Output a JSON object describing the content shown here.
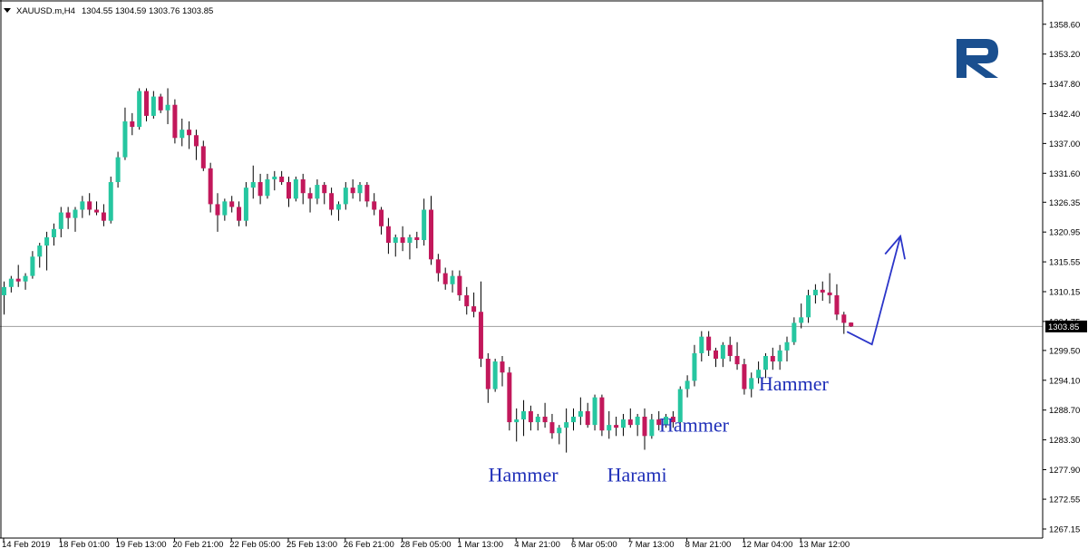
{
  "header": {
    "symbol": "XAUUSD.m,H4",
    "ohlc": "1304.55 1304.59 1303.76 1303.85"
  },
  "colors": {
    "bull": "#26c6a0",
    "bear": "#c2185b",
    "wick": "#000000",
    "price_line": "#9e9e9e",
    "annotation": "#1f2fb8",
    "arrow": "#2b35c9",
    "logo": "#1a4f8f"
  },
  "logo": {
    "icon": "roboforex-r-logo"
  },
  "annotations": [
    {
      "text": "Hammer",
      "anchor_candle": 73
    },
    {
      "text": "Harami",
      "anchor_candle": 89
    },
    {
      "text": "Hammer",
      "anchor_candle": 97
    },
    {
      "text": "Hammer",
      "anchor_candle": 111
    }
  ],
  "forecast_arrow": {
    "icon": "forecast-arrow-icon",
    "points": [
      [
        118.5,
        1302.9
      ],
      [
        122,
        1300.6
      ],
      [
        126,
        1320.2
      ]
    ]
  },
  "chart_data": {
    "type": "candlestick",
    "title": "XAUUSD.m,H4",
    "current_price": 1303.85,
    "current_price_label": "1303.85",
    "ylim": [
      1266.0,
      1362.5
    ],
    "xlim": [
      0,
      146
    ],
    "y_ticks": [
      1358.6,
      1353.2,
      1347.8,
      1342.4,
      1337.0,
      1331.6,
      1326.35,
      1320.95,
      1315.55,
      1310.15,
      1304.75,
      1299.5,
      1294.1,
      1288.7,
      1283.3,
      1277.9,
      1272.55,
      1267.15
    ],
    "y_tick_labels": [
      "1358.60",
      "1353.20",
      "1347.80",
      "1342.40",
      "1337.00",
      "1331.60",
      "1326.35",
      "1320.95",
      "1315.55",
      "1310.15",
      "1304.75",
      "1299.50",
      "1294.10",
      "1288.70",
      "1283.30",
      "1277.90",
      "1272.55",
      "1267.15"
    ],
    "x_ticks": [
      {
        "index": 0,
        "label": "14 Feb 2019"
      },
      {
        "index": 8,
        "label": "18 Feb 01:00"
      },
      {
        "index": 16,
        "label": "19 Feb 13:00"
      },
      {
        "index": 24,
        "label": "20 Feb 21:00"
      },
      {
        "index": 32,
        "label": "22 Feb 05:00"
      },
      {
        "index": 40,
        "label": "25 Feb 13:00"
      },
      {
        "index": 48,
        "label": "26 Feb 21:00"
      },
      {
        "index": 56,
        "label": "28 Feb 05:00"
      },
      {
        "index": 64,
        "label": "1 Mar 13:00"
      },
      {
        "index": 72,
        "label": "4 Mar 21:00"
      },
      {
        "index": 80,
        "label": "6 Mar 05:00"
      },
      {
        "index": 88,
        "label": "7 Mar 13:00"
      },
      {
        "index": 96,
        "label": "8 Mar 21:00"
      },
      {
        "index": 104,
        "label": "12 Mar 04:00"
      },
      {
        "index": 112,
        "label": "13 Mar 12:00"
      }
    ],
    "candles": [
      [
        1309.5,
        1312.0,
        1306.0,
        1311.0
      ],
      [
        1311.0,
        1313.0,
        1310.0,
        1312.5
      ],
      [
        1312.5,
        1315.0,
        1311.0,
        1312.0
      ],
      [
        1312.0,
        1313.5,
        1310.5,
        1313.0
      ],
      [
        1313.0,
        1317.5,
        1312.5,
        1316.5
      ],
      [
        1316.5,
        1319.0,
        1314.5,
        1318.5
      ],
      [
        1318.5,
        1321.0,
        1314.0,
        1320.0
      ],
      [
        1320.0,
        1322.5,
        1318.5,
        1321.5
      ],
      [
        1321.5,
        1325.5,
        1320.0,
        1324.5
      ],
      [
        1324.5,
        1325.5,
        1321.5,
        1323.5
      ],
      [
        1323.5,
        1325.5,
        1321.0,
        1325.0
      ],
      [
        1325.0,
        1327.5,
        1323.5,
        1326.5
      ],
      [
        1326.5,
        1328.0,
        1324.0,
        1325.0
      ],
      [
        1325.0,
        1326.5,
        1324.0,
        1324.5
      ],
      [
        1324.5,
        1326.0,
        1322.0,
        1323.0
      ],
      [
        1323.0,
        1331.0,
        1322.5,
        1330.0
      ],
      [
        1330.0,
        1335.5,
        1329.0,
        1334.5
      ],
      [
        1334.5,
        1343.5,
        1334.0,
        1341.0
      ],
      [
        1341.0,
        1342.5,
        1338.5,
        1340.0
      ],
      [
        1340.0,
        1347.0,
        1339.5,
        1346.5
      ],
      [
        1346.5,
        1347.0,
        1341.0,
        1342.0
      ],
      [
        1342.0,
        1346.5,
        1341.5,
        1345.5
      ],
      [
        1345.5,
        1346.0,
        1342.5,
        1343.0
      ],
      [
        1343.0,
        1347.0,
        1340.5,
        1344.0
      ],
      [
        1344.0,
        1345.0,
        1337.0,
        1338.0
      ],
      [
        1338.0,
        1341.5,
        1336.5,
        1339.5
      ],
      [
        1339.5,
        1341.0,
        1336.0,
        1338.5
      ],
      [
        1338.5,
        1339.5,
        1334.0,
        1336.5
      ],
      [
        1336.5,
        1337.5,
        1332.0,
        1332.5
      ],
      [
        1332.5,
        1333.5,
        1324.5,
        1326.0
      ],
      [
        1326.0,
        1328.0,
        1321.0,
        1324.0
      ],
      [
        1324.0,
        1327.0,
        1323.0,
        1326.5
      ],
      [
        1326.5,
        1327.5,
        1324.5,
        1325.5
      ],
      [
        1325.5,
        1326.5,
        1322.0,
        1323.0
      ],
      [
        1323.0,
        1330.0,
        1322.0,
        1329.0
      ],
      [
        1329.0,
        1333.0,
        1327.0,
        1330.0
      ],
      [
        1330.0,
        1331.5,
        1326.0,
        1327.5
      ],
      [
        1327.5,
        1331.5,
        1327.0,
        1330.5
      ],
      [
        1330.5,
        1332.0,
        1328.5,
        1331.0
      ],
      [
        1331.0,
        1332.0,
        1329.5,
        1330.0
      ],
      [
        1330.0,
        1331.0,
        1325.5,
        1327.0
      ],
      [
        1327.0,
        1331.0,
        1326.5,
        1330.5
      ],
      [
        1330.5,
        1331.5,
        1326.0,
        1328.0
      ],
      [
        1328.0,
        1329.0,
        1324.5,
        1327.0
      ],
      [
        1327.0,
        1330.5,
        1326.0,
        1329.5
      ],
      [
        1329.5,
        1330.0,
        1326.0,
        1328.0
      ],
      [
        1328.0,
        1329.0,
        1324.0,
        1325.0
      ],
      [
        1325.0,
        1326.5,
        1323.0,
        1326.0
      ],
      [
        1326.0,
        1330.0,
        1325.0,
        1329.0
      ],
      [
        1329.0,
        1330.5,
        1327.0,
        1328.0
      ],
      [
        1328.0,
        1330.0,
        1326.5,
        1329.5
      ],
      [
        1329.5,
        1330.0,
        1325.5,
        1326.5
      ],
      [
        1326.5,
        1328.0,
        1324.0,
        1325.0
      ],
      [
        1325.0,
        1325.5,
        1320.5,
        1322.0
      ],
      [
        1322.0,
        1323.5,
        1317.0,
        1319.0
      ],
      [
        1319.0,
        1320.5,
        1316.5,
        1320.0
      ],
      [
        1320.0,
        1322.0,
        1317.5,
        1319.0
      ],
      [
        1319.0,
        1320.5,
        1316.0,
        1320.0
      ],
      [
        1320.0,
        1321.0,
        1318.0,
        1319.5
      ],
      [
        1319.5,
        1327.0,
        1318.5,
        1325.0
      ],
      [
        1325.0,
        1327.5,
        1315.0,
        1316.0
      ],
      [
        1316.0,
        1317.0,
        1312.0,
        1313.5
      ],
      [
        1313.5,
        1314.5,
        1310.5,
        1311.5
      ],
      [
        1311.5,
        1314.0,
        1310.0,
        1313.0
      ],
      [
        1313.0,
        1314.0,
        1308.5,
        1309.5
      ],
      [
        1309.5,
        1311.0,
        1306.0,
        1307.5
      ],
      [
        1307.5,
        1310.0,
        1305.5,
        1306.5
      ],
      [
        1306.5,
        1312.0,
        1296.5,
        1298.0
      ],
      [
        1298.0,
        1299.0,
        1290.0,
        1292.5
      ],
      [
        1292.5,
        1298.0,
        1292.0,
        1297.5
      ],
      [
        1297.5,
        1298.5,
        1293.0,
        1295.5
      ],
      [
        1295.5,
        1296.5,
        1285.0,
        1286.5
      ],
      [
        1286.5,
        1289.0,
        1283.0,
        1287.0
      ],
      [
        1287.0,
        1290.5,
        1284.0,
        1288.5
      ],
      [
        1288.5,
        1289.5,
        1285.0,
        1286.5
      ],
      [
        1286.5,
        1288.0,
        1285.0,
        1287.5
      ],
      [
        1287.5,
        1290.0,
        1285.5,
        1286.5
      ],
      [
        1286.5,
        1288.0,
        1283.5,
        1284.5
      ],
      [
        1284.5,
        1286.0,
        1282.5,
        1285.5
      ],
      [
        1285.5,
        1289.0,
        1281.0,
        1286.5
      ],
      [
        1286.5,
        1289.0,
        1285.0,
        1287.5
      ],
      [
        1287.5,
        1291.0,
        1286.0,
        1288.5
      ],
      [
        1288.5,
        1290.0,
        1285.5,
        1286.0
      ],
      [
        1286.0,
        1291.5,
        1285.0,
        1291.0
      ],
      [
        1291.0,
        1291.5,
        1284.0,
        1285.0
      ],
      [
        1285.0,
        1288.5,
        1283.5,
        1286.0
      ],
      [
        1286.0,
        1287.5,
        1284.0,
        1285.5
      ],
      [
        1285.5,
        1288.0,
        1284.0,
        1287.0
      ],
      [
        1287.0,
        1289.0,
        1285.5,
        1286.0
      ],
      [
        1286.0,
        1288.0,
        1284.0,
        1287.5
      ],
      [
        1287.5,
        1289.0,
        1281.5,
        1284.0
      ],
      [
        1284.0,
        1288.0,
        1283.5,
        1287.0
      ],
      [
        1287.0,
        1288.5,
        1285.0,
        1286.0
      ],
      [
        1286.0,
        1288.0,
        1285.5,
        1287.5
      ],
      [
        1287.5,
        1288.5,
        1285.5,
        1286.5
      ],
      [
        1286.5,
        1293.0,
        1286.0,
        1292.5
      ],
      [
        1292.5,
        1295.0,
        1291.0,
        1294.0
      ],
      [
        1294.0,
        1300.5,
        1293.0,
        1299.0
      ],
      [
        1299.0,
        1303.0,
        1297.5,
        1302.0
      ],
      [
        1302.0,
        1303.0,
        1298.5,
        1299.5
      ],
      [
        1299.5,
        1300.0,
        1296.5,
        1298.0
      ],
      [
        1298.0,
        1301.0,
        1296.5,
        1300.5
      ],
      [
        1300.5,
        1302.0,
        1297.5,
        1298.5
      ],
      [
        1298.5,
        1301.0,
        1296.0,
        1297.0
      ],
      [
        1297.0,
        1298.0,
        1291.5,
        1292.5
      ],
      [
        1292.5,
        1295.5,
        1291.0,
        1294.5
      ],
      [
        1294.5,
        1297.5,
        1293.5,
        1296.0
      ],
      [
        1296.0,
        1299.0,
        1294.5,
        1298.5
      ],
      [
        1298.5,
        1300.0,
        1296.0,
        1297.5
      ],
      [
        1297.5,
        1300.5,
        1296.0,
        1299.5
      ],
      [
        1299.5,
        1302.0,
        1297.5,
        1301.0
      ],
      [
        1301.0,
        1305.5,
        1300.5,
        1304.5
      ],
      [
        1304.5,
        1308.0,
        1303.5,
        1305.5
      ],
      [
        1305.5,
        1310.5,
        1304.5,
        1309.5
      ],
      [
        1309.5,
        1311.5,
        1308.0,
        1310.5
      ],
      [
        1310.5,
        1312.0,
        1308.5,
        1310.0
      ],
      [
        1310.0,
        1313.5,
        1308.0,
        1309.5
      ],
      [
        1309.5,
        1311.5,
        1305.0,
        1306.0
      ],
      [
        1306.0,
        1306.5,
        1302.5,
        1304.5
      ],
      [
        1304.55,
        1304.59,
        1303.76,
        1303.85
      ]
    ]
  }
}
